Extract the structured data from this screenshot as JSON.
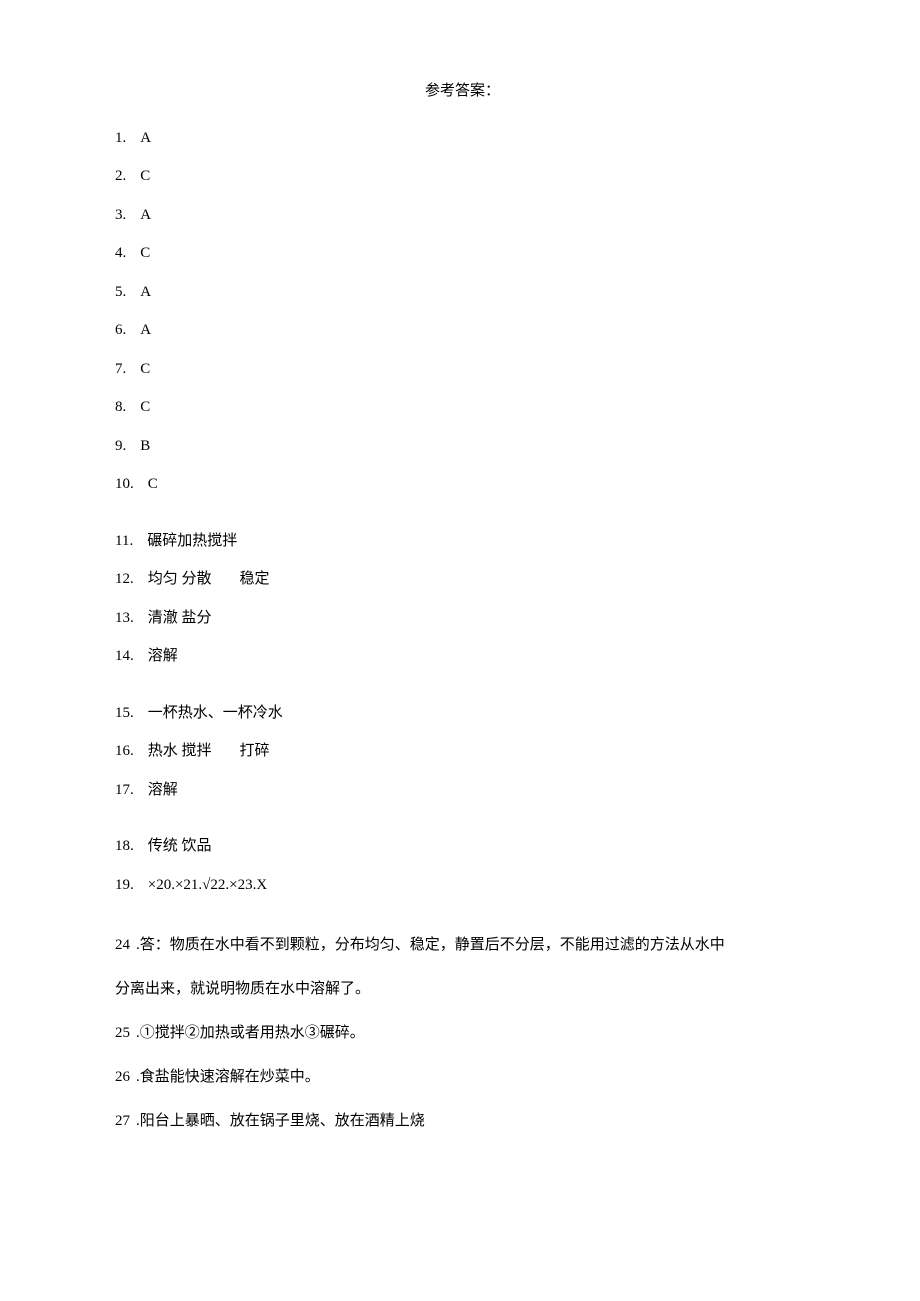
{
  "title": "参考答案：",
  "mc_answers": [
    {
      "num": "1.",
      "ans": "A"
    },
    {
      "num": "2.",
      "ans": "C"
    },
    {
      "num": "3.",
      "ans": "A"
    },
    {
      "num": "4.",
      "ans": "C"
    },
    {
      "num": "5.",
      "ans": "A"
    },
    {
      "num": "6.",
      "ans": "A"
    },
    {
      "num": "7.",
      "ans": "C"
    },
    {
      "num": "8.",
      "ans": "C"
    },
    {
      "num": "9.",
      "ans": "B"
    },
    {
      "num": "10.",
      "ans": "C"
    }
  ],
  "fill_group1": [
    {
      "num": "11.",
      "parts": [
        "碾碎加热搅拌"
      ]
    },
    {
      "num": "12.",
      "parts": [
        "均匀 分散",
        "稳定"
      ]
    },
    {
      "num": "13.",
      "parts": [
        "清澈 盐分"
      ]
    },
    {
      "num": "14.",
      "parts": [
        "溶解"
      ]
    }
  ],
  "fill_group2": [
    {
      "num": "15.",
      "parts": [
        "一杯热水、一杯冷水"
      ]
    },
    {
      "num": "16.",
      "parts": [
        "热水 搅拌",
        "打碎"
      ]
    },
    {
      "num": "17.",
      "parts": [
        "溶解"
      ]
    }
  ],
  "fill_group3": [
    {
      "num": "18.",
      "parts": [
        "传统 饮品"
      ]
    },
    {
      "num": "19.",
      "parts": [
        "×20.×21.√22.×23.X"
      ]
    }
  ],
  "long_answers": {
    "q24": {
      "num": "24",
      "prefix": ".答：",
      "line1": "物质在水中看不到颗粒，分布均匀、稳定，静置后不分层，不能用过滤的方法从水中",
      "line2": "分离出来，就说明物质在水中溶解了。"
    },
    "q25": {
      "num": "25",
      "text": ".①搅拌②加热或者用热水③碾碎。"
    },
    "q26": {
      "num": "26",
      "text": ".食盐能快速溶解在炒菜中。"
    },
    "q27": {
      "num": "27",
      "text": ".阳台上暴晒、放在锅子里烧、放在酒精上烧"
    }
  }
}
